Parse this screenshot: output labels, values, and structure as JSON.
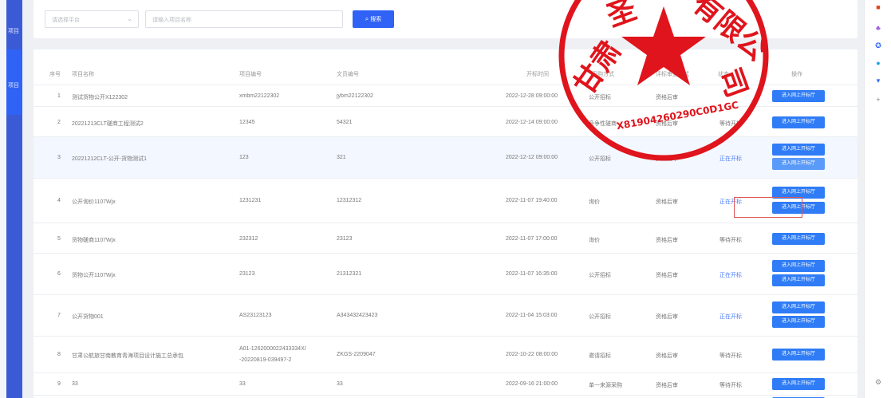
{
  "sidebar": {
    "label_top": "项目",
    "label_active": "项目"
  },
  "filters": {
    "platform_placeholder": "请选择平台",
    "project_placeholder": "请输入项目名称",
    "search_label": "搜索",
    "search_icon": "search-icon"
  },
  "table": {
    "headers": {
      "index": "序号",
      "name": "项目名称",
      "project_no": "项目编号",
      "file_no": "文员编号",
      "open_time": "开标时间",
      "purchase_method": "采购方式",
      "review_method": "评标审查方式",
      "status": "状态",
      "action": "操作"
    },
    "rows": [
      {
        "index": "1",
        "name": "测试货物公开X122302",
        "project_no": "xmbm22122302",
        "file_no": "jybm22122302",
        "open_time": "2022-12-28 09:00:00",
        "method": "公开招标",
        "review": "资格后审",
        "status": "",
        "buttons": [
          "进入网上开标厅"
        ]
      },
      {
        "index": "2",
        "name": "20221213CLT磋商工程测试2",
        "project_no": "12345",
        "file_no": "54321",
        "open_time": "2022-12-14 09:00:00",
        "method": "竞争性磋商",
        "review": "资格后审",
        "status": "等待开标",
        "buttons": [
          "进入网上开标厅"
        ]
      },
      {
        "index": "3",
        "name": "20221212CLT-公开-货物测试1",
        "project_no": "123",
        "file_no": "321",
        "open_time": "2022-12-12 09:00:00",
        "method": "公开招标",
        "review": "资格后审",
        "status": "正在开标",
        "buttons": [
          "进入网上开标厅",
          "进入网上开标厅"
        ]
      },
      {
        "index": "4",
        "name": "公开询价1107Wjx",
        "project_no": "1231231",
        "file_no": "12312312",
        "open_time": "2022-11-07 19:40:00",
        "method": "询价",
        "review": "资格后审",
        "status": "正在开标",
        "buttons": [
          "进入网上开标厅",
          "进入网上开标厅"
        ]
      },
      {
        "index": "5",
        "name": "货物磋商1107Wjx",
        "project_no": "232312",
        "file_no": "23123",
        "open_time": "2022-11-07 17:00:00",
        "method": "询价",
        "review": "资格后审",
        "status": "等待开标",
        "buttons": [
          "进入网上开标厅"
        ]
      },
      {
        "index": "6",
        "name": "货物公开1107Wjx",
        "project_no": "23123",
        "file_no": "21312321",
        "open_time": "2022-11-07 16:35:00",
        "method": "公开招标",
        "review": "资格后审",
        "status": "正在开标",
        "buttons": [
          "进入网上开标厅",
          "进入网上开标厅"
        ]
      },
      {
        "index": "7",
        "name": "公开货物001",
        "project_no": "AS23123123",
        "file_no": "A343432423423",
        "open_time": "2022-11-04 15:03:00",
        "method": "公开招标",
        "review": "资格后审",
        "status": "正在开标",
        "buttons": [
          "进入网上开标厅",
          "进入网上开标厅"
        ]
      },
      {
        "index": "8",
        "name": "甘肃公航旅甘南教育青海项目设计施工总承包",
        "project_no": "A01-1262000022433334X/",
        "project_no_2": "-20220819-039497-2",
        "file_no": "ZKGS-2209047",
        "open_time": "2022-10-22 08:00:00",
        "method": "邀请招标",
        "review": "资格后审",
        "status": "等待开标",
        "buttons": [
          "进入网上开标厅"
        ]
      },
      {
        "index": "9",
        "name": "33",
        "project_no": "33",
        "file_no": "33",
        "open_time": "2022-09-16 21:00:00",
        "method": "单一来源采购",
        "review": "资格后审",
        "status": "等待开标",
        "buttons": [
          "进入网上开标厅"
        ]
      }
    ]
  },
  "seal": {
    "chars_left": "甘肃",
    "chars_top": "圣",
    "chars_right": "有限公",
    "chars_right2": "司",
    "code": "X81904260290C0D1GC"
  },
  "colors": {
    "primary": "#2f62f5",
    "seal_red": "#e0141c",
    "highlight_box": "#e05555"
  }
}
